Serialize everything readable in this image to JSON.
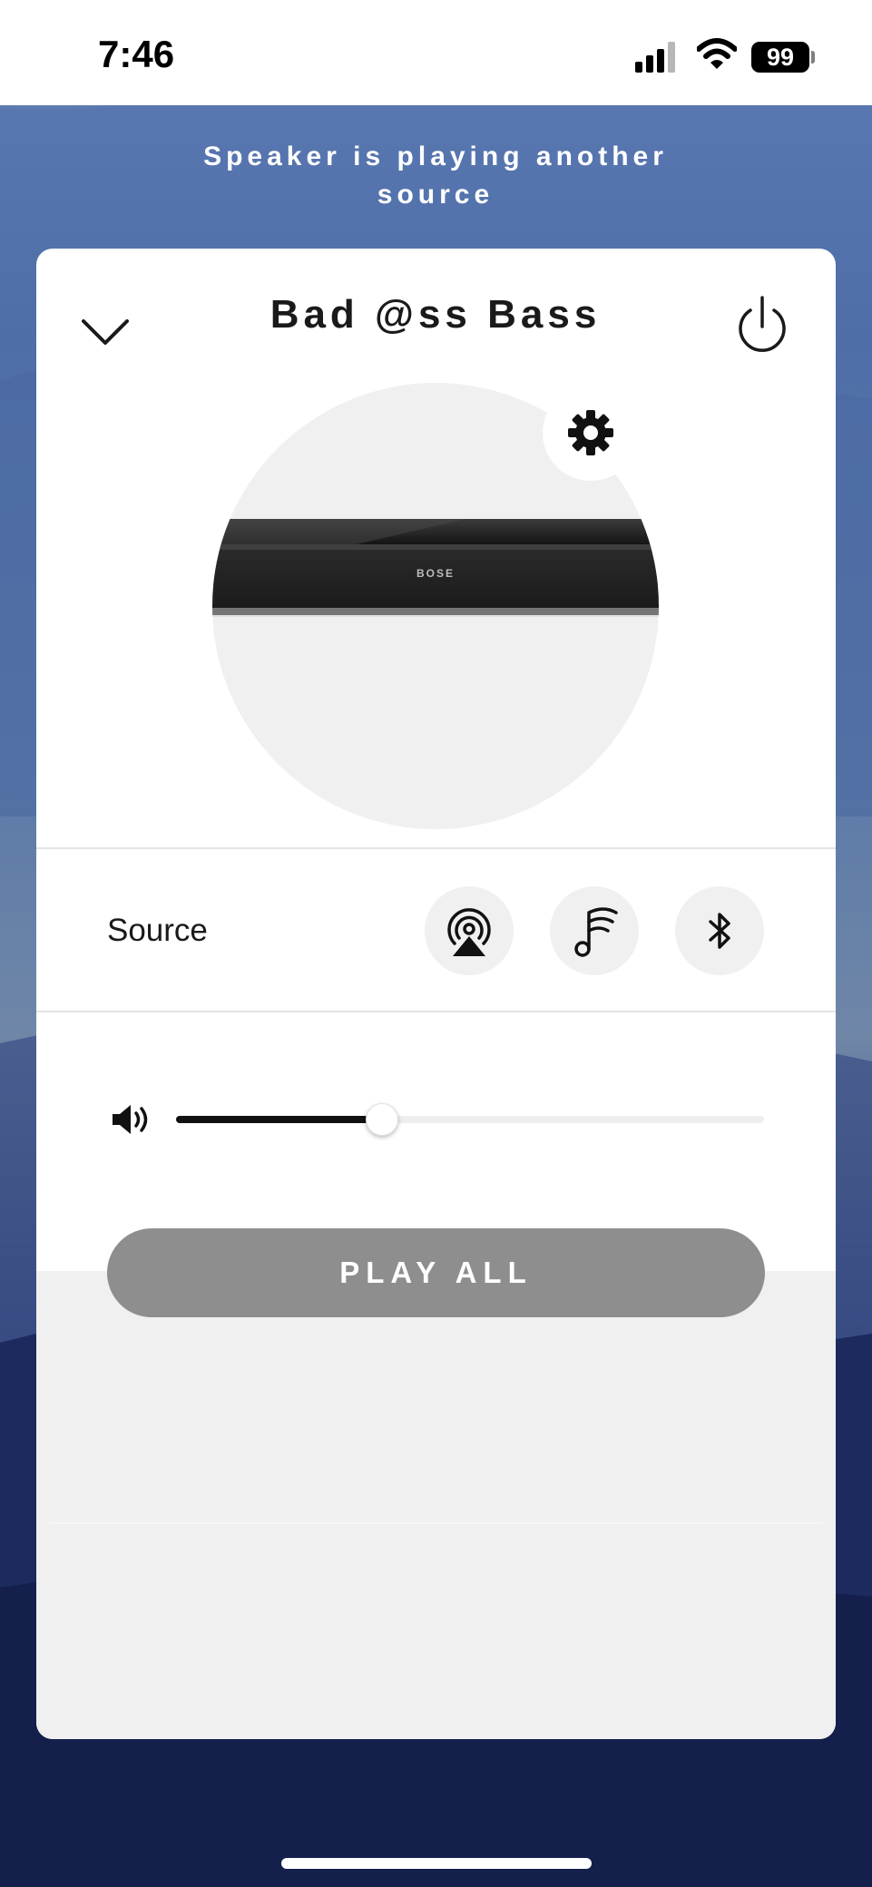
{
  "status_bar": {
    "time": "7:46",
    "battery": "99",
    "icons": [
      "cellular-signal-icon",
      "wifi-icon",
      "battery-icon"
    ]
  },
  "banner": {
    "text": "Speaker is playing another source"
  },
  "device_card": {
    "title": "Bad @ss Bass",
    "collapse_icon": "chevron-down-icon",
    "power_icon": "power-icon",
    "settings_icon": "gear-icon",
    "speaker_brand": "BOSE"
  },
  "source": {
    "label": "Source",
    "options": [
      {
        "name": "airplay",
        "icon": "airplay-icon"
      },
      {
        "name": "music-service",
        "icon": "music-wifi-icon"
      },
      {
        "name": "bluetooth",
        "icon": "bluetooth-icon"
      }
    ]
  },
  "volume": {
    "icon": "speaker-volume-icon",
    "level_percent": 35
  },
  "play_all": {
    "label": "PLAY ALL"
  },
  "colors": {
    "card_bg": "#ffffff",
    "lower_panel": "#f0f0f0",
    "button_disabled": "#8e8e8e",
    "source_bubble": "#f0f0f0",
    "slider_fill": "#111111"
  }
}
